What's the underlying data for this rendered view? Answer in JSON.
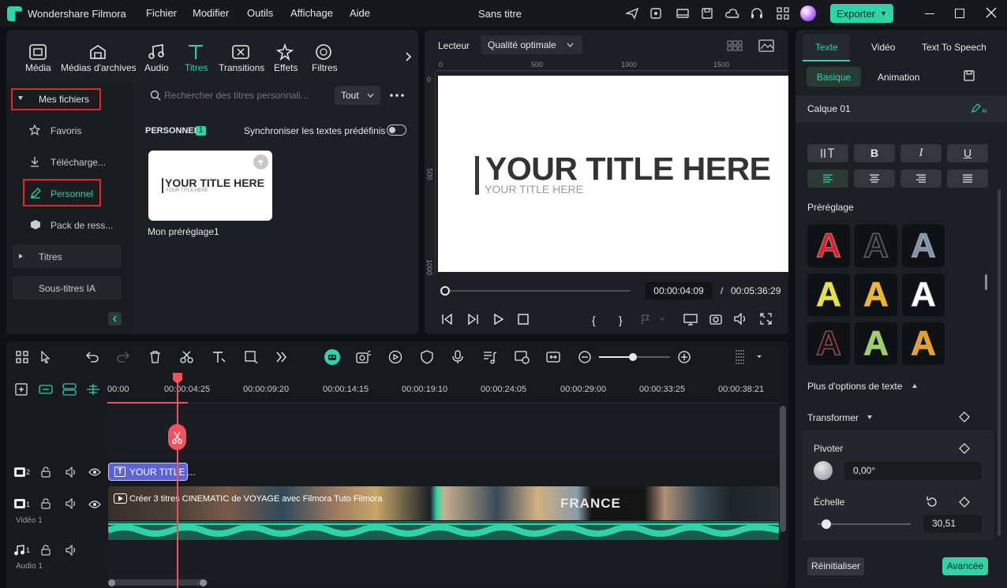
{
  "app": {
    "title": "Wondershare Filmora",
    "project": "Sans titre",
    "export_label": "Exporter"
  },
  "menu": [
    "Fichier",
    "Modifier",
    "Outils",
    "Affichage",
    "Aide"
  ],
  "media_tabs": [
    {
      "label": "Média",
      "icon": "media-icon"
    },
    {
      "label": "Médias d'archives",
      "icon": "stock-media-icon"
    },
    {
      "label": "Audio",
      "icon": "audio-icon"
    },
    {
      "label": "Titres",
      "icon": "titles-icon"
    },
    {
      "label": "Transitions",
      "icon": "transitions-icon"
    },
    {
      "label": "Effets",
      "icon": "effects-icon"
    },
    {
      "label": "Filtres",
      "icon": "filters-icon"
    }
  ],
  "sidebar": {
    "mes_fichiers": "Mes fichiers",
    "favoris": "Favoris",
    "telecharge": "Télécharge...",
    "personnel": "Personnel",
    "pack": "Pack de ress...",
    "titres": "Titres",
    "sous_titres": "Sous-titres IA"
  },
  "search": {
    "placeholder": "Rechercher des titres personnali...",
    "filter": "Tout"
  },
  "personal": {
    "header": "PERSONNEL",
    "count": "1",
    "sync_label": "Synchroniser les textes prédéfinis",
    "item_name": "Mon préréglage1",
    "thumb_title": "YOUR TITLE HERE",
    "thumb_sub": "YOUR TITLE HERE"
  },
  "player": {
    "label": "Lecteur",
    "quality": "Qualité optimale",
    "ruler": [
      "0",
      "500",
      "1000",
      "1500"
    ],
    "vruler": [
      "0",
      "500",
      "1000"
    ],
    "title_text": "YOUR TITLE HERE",
    "subtitle_text": "YOUR TITLE HERE",
    "current_time": "00:00:04:09",
    "sep": "/",
    "total_time": "00:05:36:29",
    "progress": 0.01
  },
  "timeline": {
    "ruler": [
      "00:00",
      "00:00:04:25",
      "00:00:09:20",
      "00:00:14:15",
      "00:00:19:10",
      "00:00:24:05",
      "00:00:29:00",
      "00:00:33:25",
      "00:00:38:21"
    ],
    "track2_num": "2",
    "track1_num": "1",
    "track1_label": "Vidéo 1",
    "audio_num": "1",
    "audio_label": "Audio 1",
    "title_clip": "YOUR TITLE ...",
    "video_clip": "Créer 3 titres CINEMATIC de VOYAGE avec Filmora  Tuto Filmora",
    "france_text": "FRANCE"
  },
  "right": {
    "tabs": [
      "Texte",
      "Vidéo",
      "Text To Speech"
    ],
    "subtabs": [
      "Basique",
      "Animation"
    ],
    "layer": "Calque 01",
    "preset_label": "Préréglage",
    "more_options": "Plus d'options de texte",
    "transform": "Transformer",
    "rotate_label": "Pivoter",
    "rotate_value": "0,00°",
    "scale_label": "Échelle",
    "scale_value": "30,51",
    "reset": "Réinitialiser",
    "advanced": "Avancée",
    "bold": "B",
    "italic": "I",
    "underline": "U",
    "presets": [
      {
        "letter": "A",
        "color": "#d91e2b"
      },
      {
        "letter": "A",
        "color": "#16181c"
      },
      {
        "letter": "A",
        "color": "#7f93a8"
      },
      {
        "letter": "A",
        "color": "#e8e13a"
      },
      {
        "letter": "A",
        "color": "#f2b51c"
      },
      {
        "letter": "A",
        "color": "#ffffff"
      },
      {
        "letter": "A",
        "color": "#2b0a0c"
      },
      {
        "letter": "A",
        "color": "#9ad15a"
      },
      {
        "letter": "A",
        "color": "#f09a18"
      }
    ]
  },
  "colors": {
    "accent": "#2fd3a6",
    "red": "#e0262f",
    "playhead": "#f0535d"
  }
}
